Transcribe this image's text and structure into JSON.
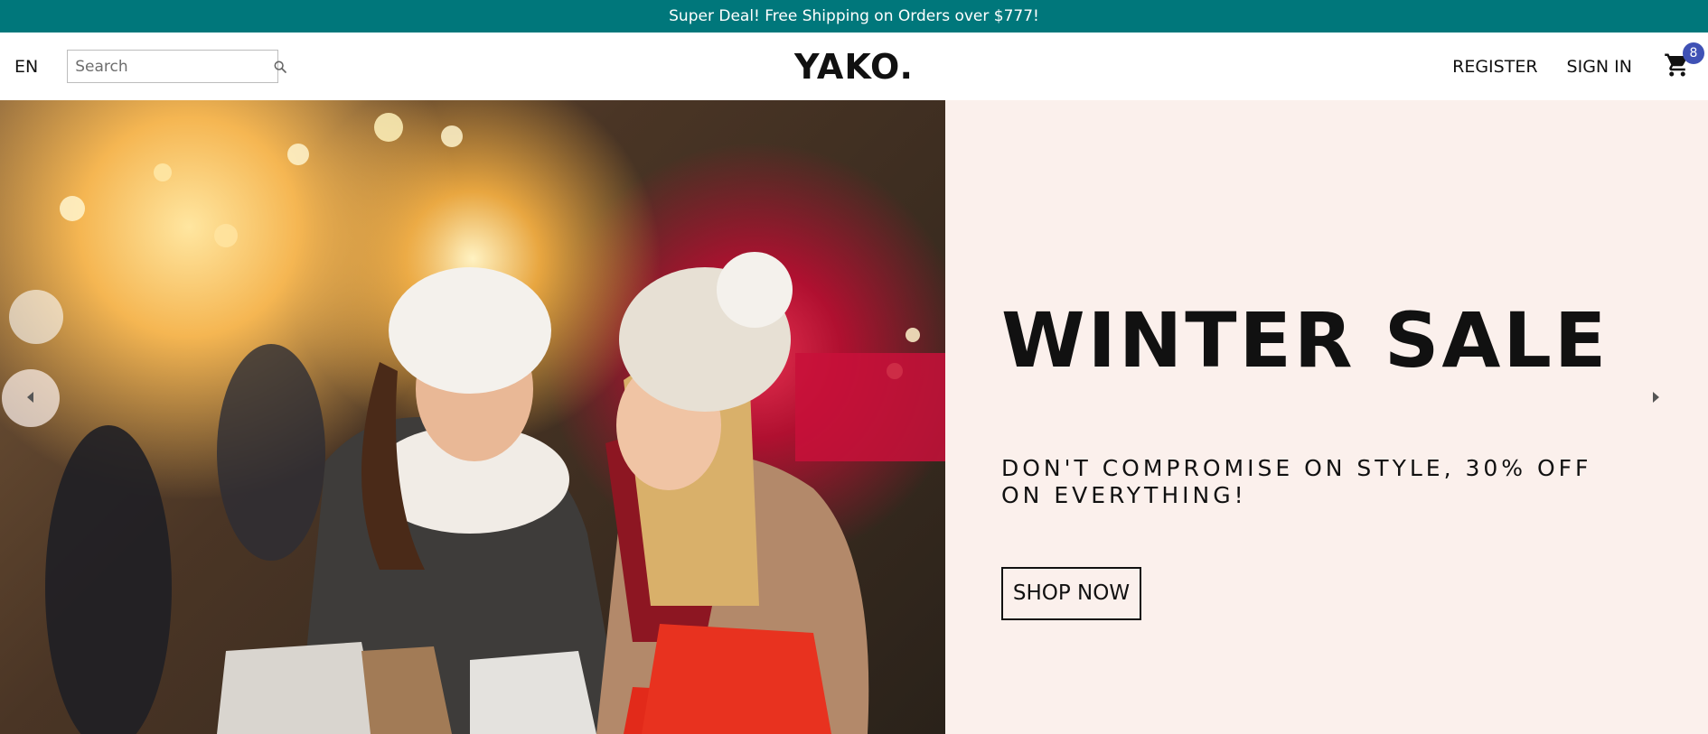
{
  "announcement": {
    "text": "Super Deal! Free Shipping on Orders over $777!"
  },
  "navbar": {
    "language": "EN",
    "search": {
      "placeholder": "Search",
      "value": ""
    },
    "logo": "YAKO.",
    "register": "REGISTER",
    "sign_in": "SIGN IN",
    "cart_count": "8"
  },
  "slide": {
    "title": "WINTER SALE",
    "description": "DON'T COMPROMISE ON STYLE, 30% OFF ON EVERYTHING!",
    "button": "SHOP NOW",
    "background": "#fbf0ec"
  },
  "icons": {
    "search": "search-icon",
    "cart": "cart-icon",
    "arrow_left": "arrow-left-icon",
    "arrow_right": "arrow-right-icon"
  },
  "colors": {
    "announcement_bg": "#00777b",
    "badge_bg": "#3f51b5"
  }
}
